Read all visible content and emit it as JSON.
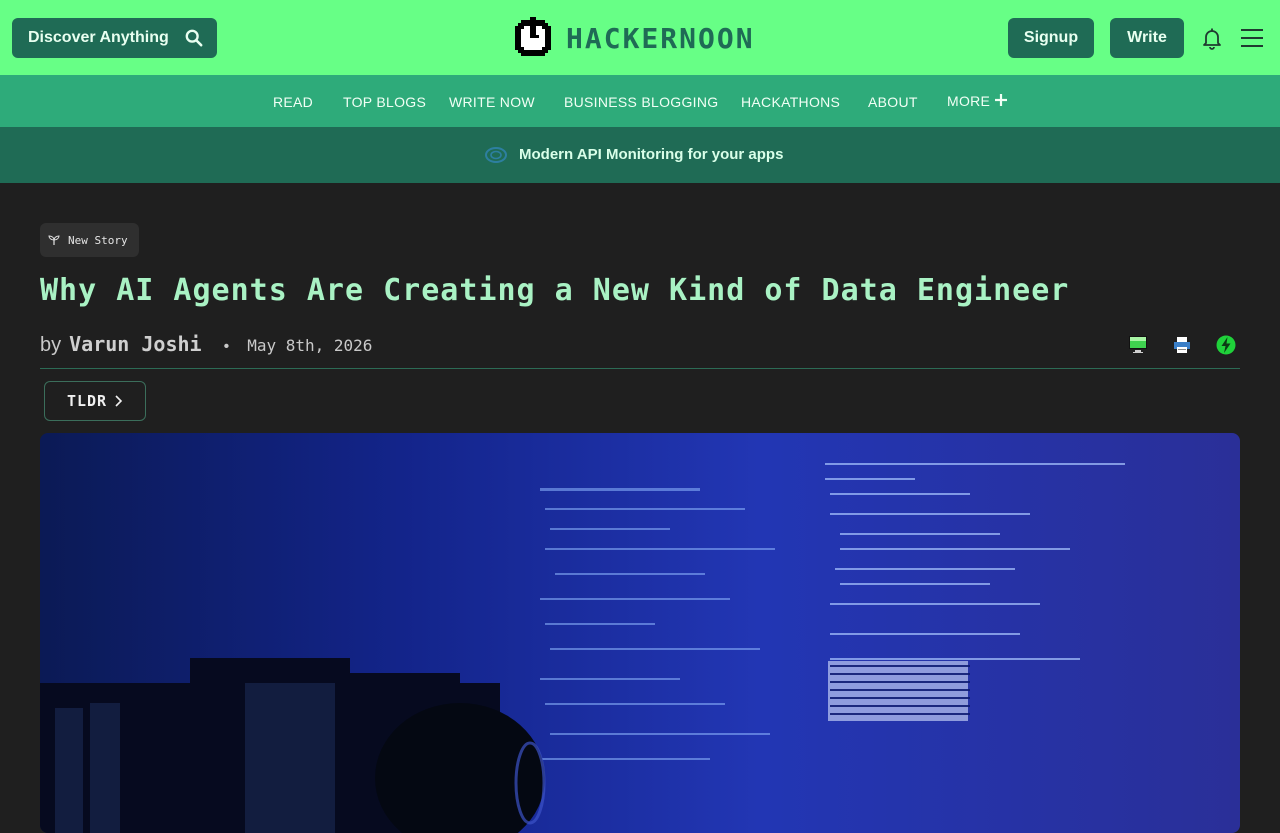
{
  "header": {
    "search_label": "Discover Anything",
    "logo_text": "HACKERNOON",
    "signup_label": "Signup",
    "write_label": "Write"
  },
  "nav": {
    "items": [
      "READ",
      "TOP BLOGS",
      "WRITE NOW",
      "BUSINESS BLOGGING",
      "HACKATHONS",
      "ABOUT",
      "MORE"
    ]
  },
  "promo": {
    "text": "Modern API Monitoring for your apps"
  },
  "article": {
    "tag": "New Story",
    "title": "Why AI Agents Are Creating a New Kind of Data Engineer",
    "by": "by",
    "author": "Varun Joshi",
    "date": "May 8th, 2026",
    "tldr_label": "TLDR",
    "hero_image": "person-in-front-of-code-screen-image"
  },
  "colors": {
    "header_bg": "#67ff86",
    "nav_bg": "#2eab7a",
    "promo_bg": "#1f6b55",
    "page_bg": "#1f1f1f",
    "title": "#a9f2c4"
  },
  "icons": {
    "search": "search-icon",
    "bell": "bell-icon",
    "menu": "hamburger-menu-icon",
    "plus": "plus-icon",
    "screen": "monitor-icon",
    "print": "printer-icon",
    "bolt": "lightning-icon"
  }
}
